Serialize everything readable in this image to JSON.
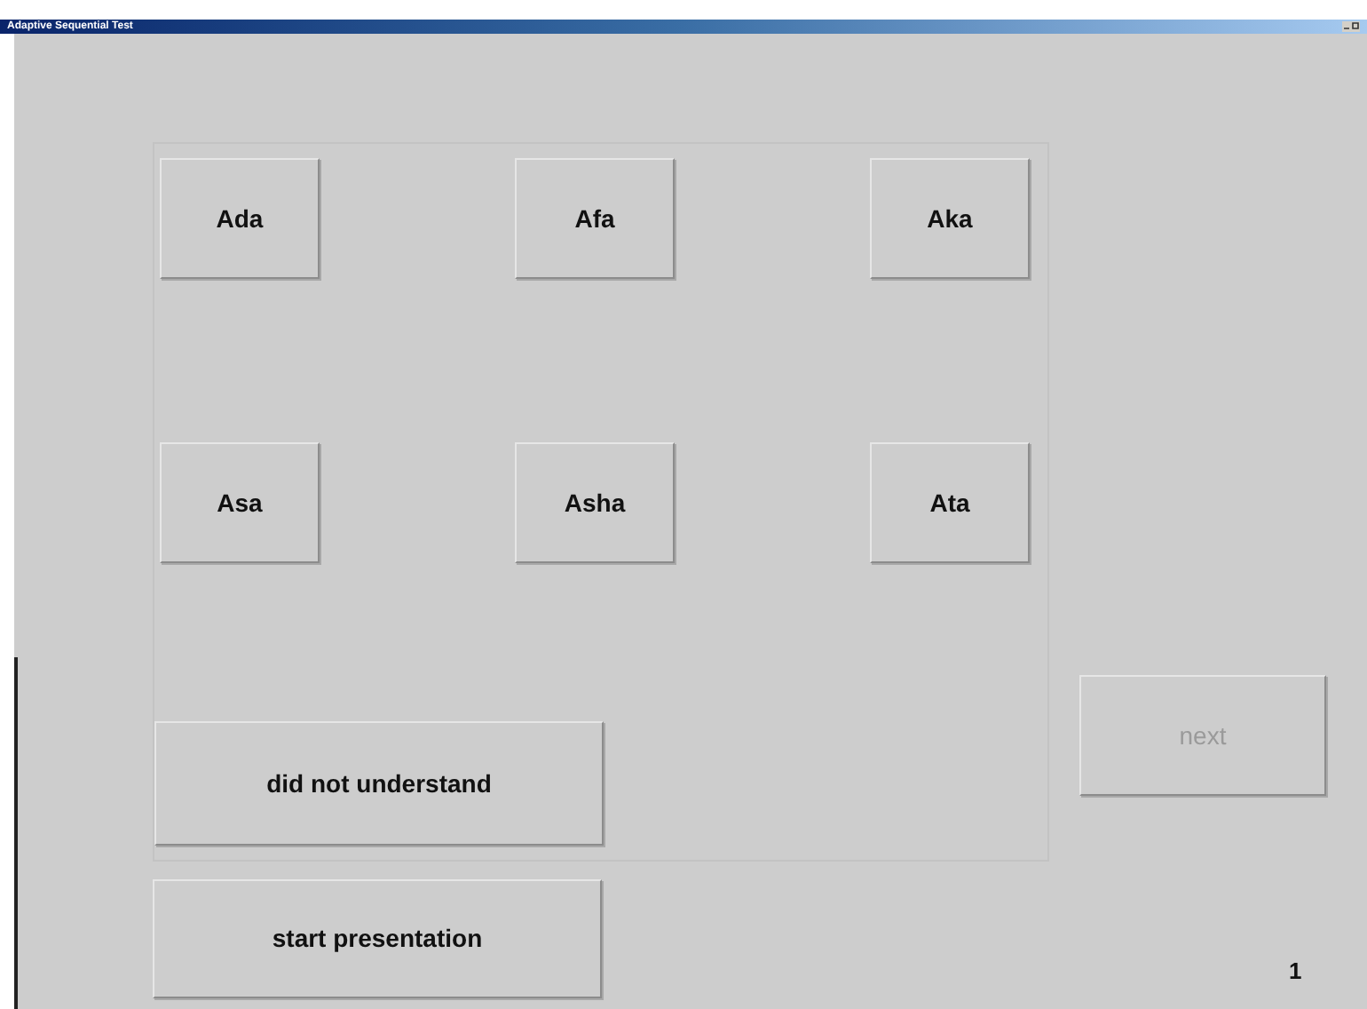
{
  "window": {
    "title": "Adaptive Sequential Test"
  },
  "choices": [
    {
      "label": "Ada"
    },
    {
      "label": "Afa"
    },
    {
      "label": "Aka"
    },
    {
      "label": "Asa"
    },
    {
      "label": "Asha"
    },
    {
      "label": "Ata"
    }
  ],
  "did_not_understand": {
    "label": "did not understand",
    "disabled": false
  },
  "start_presentation": {
    "label": "start presentation",
    "disabled": false
  },
  "next": {
    "label": "next",
    "disabled": true
  },
  "counter": "1"
}
